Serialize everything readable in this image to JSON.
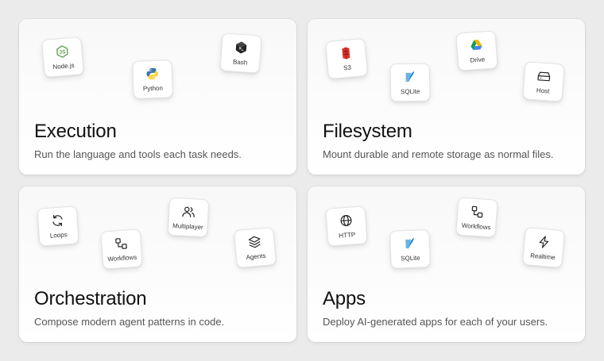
{
  "cards": [
    {
      "title": "Execution",
      "description": "Run the language and tools each task needs.",
      "tiles": [
        {
          "label": "Node.js",
          "icon": "nodejs-icon"
        },
        {
          "label": "Python",
          "icon": "python-icon"
        },
        {
          "label": "Bash",
          "icon": "bash-icon"
        }
      ]
    },
    {
      "title": "Filesystem",
      "description": "Mount durable and remote storage as normal files.",
      "tiles": [
        {
          "label": "S3",
          "icon": "s3-icon"
        },
        {
          "label": "SQLite",
          "icon": "sqlite-icon"
        },
        {
          "label": "Drive",
          "icon": "google-drive-icon"
        },
        {
          "label": "Host",
          "icon": "host-drive-icon"
        }
      ]
    },
    {
      "title": "Orchestration",
      "description": "Compose modern agent patterns in code.",
      "tiles": [
        {
          "label": "Loops",
          "icon": "loop-arrows-icon"
        },
        {
          "label": "Workflows",
          "icon": "workflow-icon"
        },
        {
          "label": "Multiplayer",
          "icon": "users-icon"
        },
        {
          "label": "Agents",
          "icon": "layers-icon"
        }
      ]
    },
    {
      "title": "Apps",
      "description": "Deploy AI-generated apps for each of your users.",
      "tiles": [
        {
          "label": "HTTP",
          "icon": "globe-icon"
        },
        {
          "label": "SQLite",
          "icon": "sqlite-icon"
        },
        {
          "label": "Workflows",
          "icon": "workflow-icon"
        },
        {
          "label": "Realtime",
          "icon": "lightning-icon"
        }
      ]
    }
  ],
  "colors": {
    "background": "#ebebeb",
    "card": "#ffffff",
    "title": "#111111",
    "description": "#555555",
    "nodejs": "#5fa04e",
    "python_blue": "#3776ab",
    "python_yellow": "#ffd43b",
    "s3_red": "#e0322b",
    "sqlite_blue": "#0f80cc",
    "drive_green": "#0f9d58",
    "drive_yellow": "#f4b400",
    "drive_blue": "#4285f4"
  }
}
